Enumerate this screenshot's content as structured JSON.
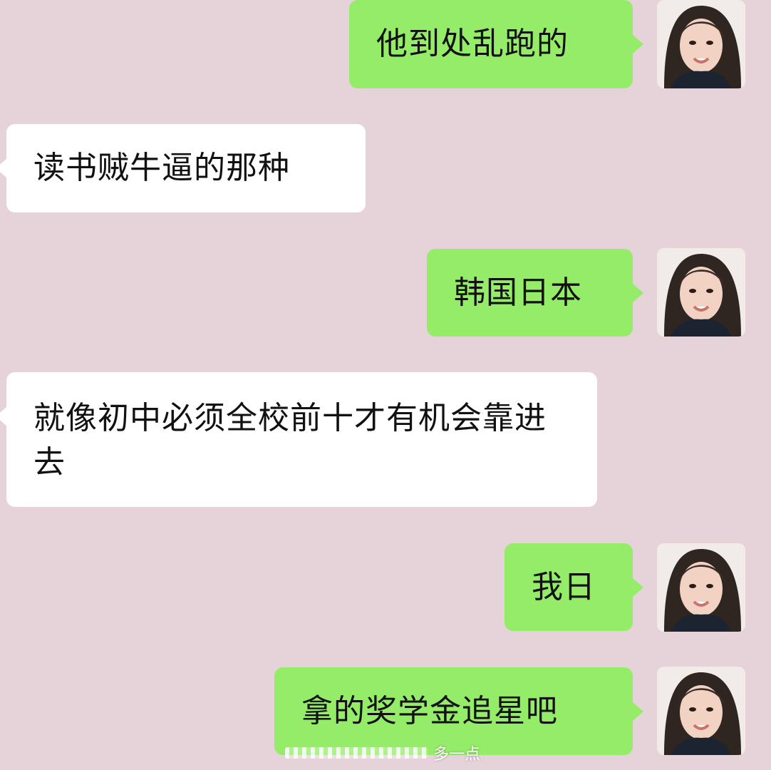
{
  "messages": [
    {
      "side": "right",
      "text": "他到处乱跑的"
    },
    {
      "side": "left",
      "text": "读书贼牛逼的那种"
    },
    {
      "side": "right",
      "text": "韩国日本"
    },
    {
      "side": "left",
      "text": "就像初中必须全校前十才有机会靠进去"
    },
    {
      "side": "right",
      "text": "我日"
    },
    {
      "side": "right",
      "text": "拿的奖学金追星吧"
    }
  ],
  "watermark": {
    "text": "多一点"
  },
  "colors": {
    "background": "#e6d3da",
    "sent_bubble": "#95ec69",
    "received_bubble": "#ffffff"
  },
  "icons": {
    "avatar": "user-avatar-photo"
  }
}
